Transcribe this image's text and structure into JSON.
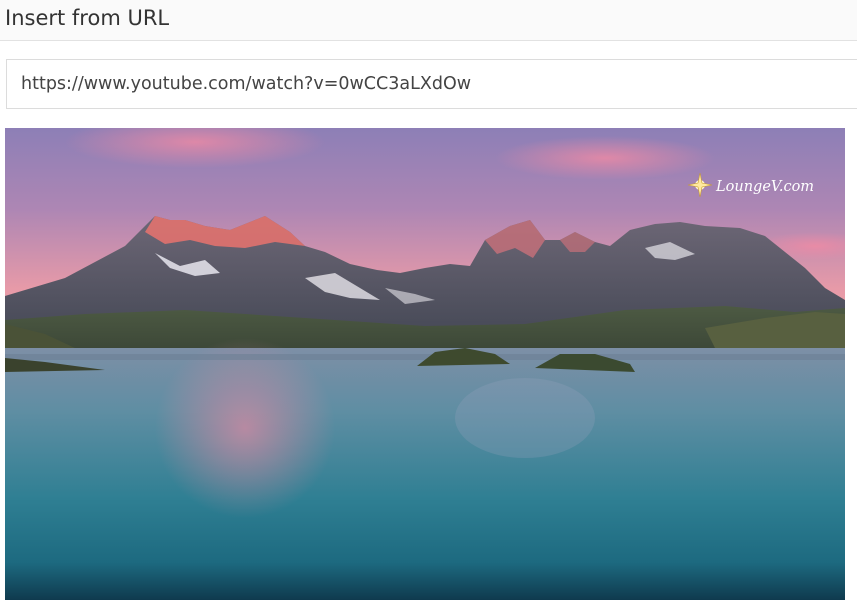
{
  "dialog": {
    "title": "Insert from URL"
  },
  "url_field": {
    "value": "https://www.youtube.com/watch?v=0wCC3aLXdOw"
  },
  "preview": {
    "watermark_text": "LoungeV.com",
    "watermark_icon": "compass-star-icon"
  }
}
